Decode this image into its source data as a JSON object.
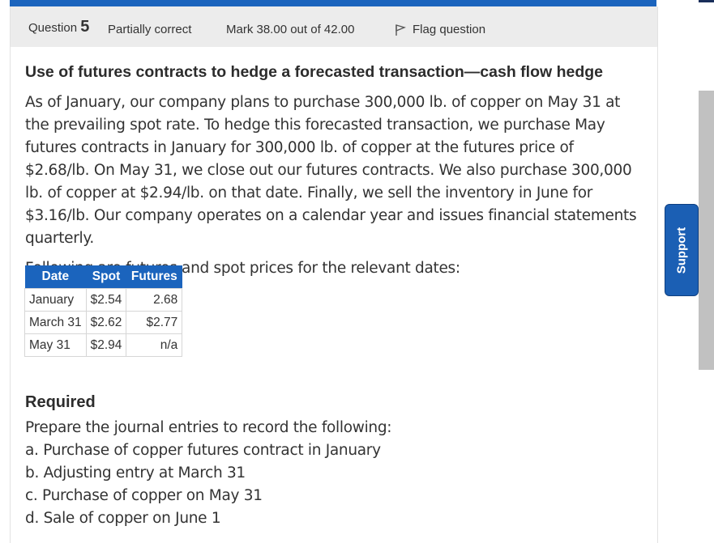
{
  "question": {
    "label": "Question",
    "number": "5",
    "state": "Partially correct",
    "grade": "Mark 38.00 out of 42.00",
    "flag_label": "Flag question"
  },
  "title": "Use of futures contracts to hedge a forecasted transaction—cash flow hedge",
  "body": "As of January, our company plans to purchase 300,000 lb. of copper on May 31 at the prevailing spot rate. To hedge this forecasted transaction, we purchase May futures contracts in January for 300,000 lb. of copper at the futures price of $2.68/lb. On May 31, we close out our futures contracts. We also purchase 300,000 lb. of copper at $2.94/lb. on that date. Finally, we sell the inventory in June for $3.16/lb. Our company operates on a calendar year and issues financial statements quarterly.",
  "intro": "Following are futures and spot prices for the relevant dates:",
  "table": {
    "headers": [
      "Date",
      "Spot",
      "Futures"
    ],
    "rows": [
      [
        "January",
        "$2.54",
        "2.68"
      ],
      [
        "March 31",
        "$2.62",
        "$2.77"
      ],
      [
        "May 31",
        "$2.94",
        "n/a"
      ]
    ]
  },
  "required": {
    "heading": "Required",
    "prompt": "Prepare the journal entries to record the following:",
    "items": [
      "a. Purchase of copper futures contract in January",
      "b. Adjusting entry at March 31",
      "c. Purchase of copper on May 31",
      "d. Sale of copper on June 1"
    ]
  },
  "support_label": "Support",
  "colors": {
    "accent": "#1b64bd",
    "header_bg": "#ececec"
  }
}
